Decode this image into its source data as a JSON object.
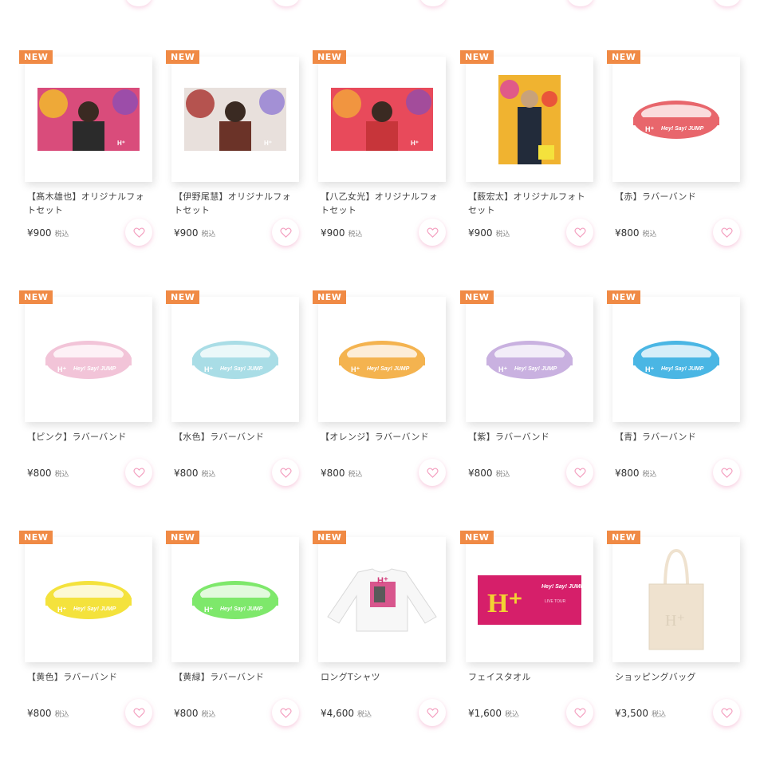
{
  "badge_label": "NEW",
  "tax_label": "税込",
  "products": [
    {
      "name": "【髙木雄也】オリジナルフォトセット",
      "price": "¥900",
      "kind": "photo-landscape",
      "colors": [
        "#d94c7b",
        "#2b2b2b",
        "#f2c028"
      ]
    },
    {
      "name": "【伊野尾慧】オリジナルフォトセット",
      "price": "¥900",
      "kind": "photo-landscape",
      "colors": [
        "#e8e0dc",
        "#6b3328",
        "#a8302c"
      ]
    },
    {
      "name": "【八乙女光】オリジナルフォトセット",
      "price": "¥900",
      "kind": "photo-landscape",
      "colors": [
        "#e84a5b",
        "#c7353a",
        "#f3a83a"
      ]
    },
    {
      "name": "【薮宏太】オリジナルフォトセット",
      "price": "¥900",
      "kind": "photo-portrait",
      "colors": [
        "#f0b330",
        "#222b3a",
        "#e05a88"
      ]
    },
    {
      "name": "【赤】ラバーバンド",
      "price": "¥800",
      "kind": "band",
      "colors": [
        "#e8666c"
      ]
    },
    {
      "name": "【ピンク】ラバーバンド",
      "price": "¥800",
      "kind": "band",
      "colors": [
        "#f2c4d8"
      ]
    },
    {
      "name": "【水色】ラバーバンド",
      "price": "¥800",
      "kind": "band",
      "colors": [
        "#a9dde6"
      ]
    },
    {
      "name": "【オレンジ】ラバーバンド",
      "price": "¥800",
      "kind": "band",
      "colors": [
        "#f4b34f"
      ]
    },
    {
      "name": "【紫】ラバーバンド",
      "price": "¥800",
      "kind": "band",
      "colors": [
        "#c9b1e0"
      ]
    },
    {
      "name": "【青】ラバーバンド",
      "price": "¥800",
      "kind": "band",
      "colors": [
        "#4ab6e4"
      ]
    },
    {
      "name": "【黄色】ラバーバンド",
      "price": "¥800",
      "kind": "band",
      "colors": [
        "#f4e23c"
      ]
    },
    {
      "name": "【黄緑】ラバーバンド",
      "price": "¥800",
      "kind": "band",
      "colors": [
        "#7ee86b"
      ]
    },
    {
      "name": "ロングTシャツ",
      "price": "¥4,600",
      "kind": "shirt",
      "colors": [
        "#f7f7f7",
        "#d23a7a"
      ]
    },
    {
      "name": "フェイスタオル",
      "price": "¥1,600",
      "kind": "towel",
      "colors": [
        "#d61f6a",
        "#f3d233"
      ]
    },
    {
      "name": "ショッピングバッグ",
      "price": "¥3,500",
      "kind": "bag",
      "colors": [
        "#efe2cf"
      ]
    }
  ]
}
